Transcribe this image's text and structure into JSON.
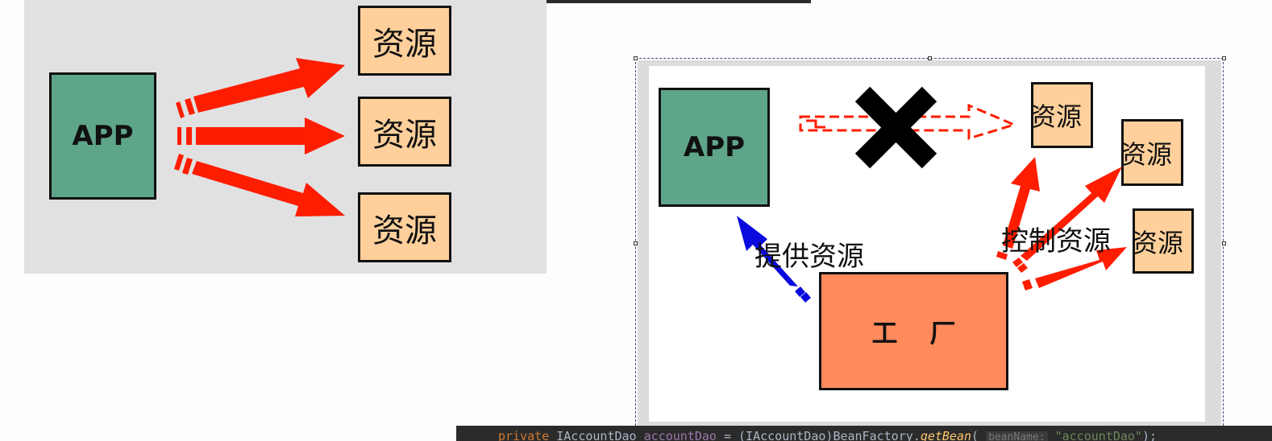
{
  "left_diagram": {
    "app_label": "APP",
    "resources": [
      "资源",
      "资源",
      "资源"
    ],
    "arrow_color": "#ff1d00"
  },
  "right_diagram": {
    "app_label": "APP",
    "resources": [
      "资源",
      "资源",
      "资源"
    ],
    "factory_label": "工厂",
    "provide_label": "提供资源",
    "control_label": "控制资源",
    "provide_arrow_color": "#0a0adf",
    "control_arrow_color": "#ff1d00",
    "cross_icon": "x-mark"
  },
  "code_line": {
    "keyword": "private",
    "type": "IAccountDao",
    "field": "accountDao",
    "equals": "=",
    "cast": "(IAccountDao)",
    "class_name": "BeanFactory.",
    "method": "getBean",
    "open_paren": "(",
    "param_hint": "beanName:",
    "string_value": "\"accountDao\"",
    "close": ");"
  }
}
